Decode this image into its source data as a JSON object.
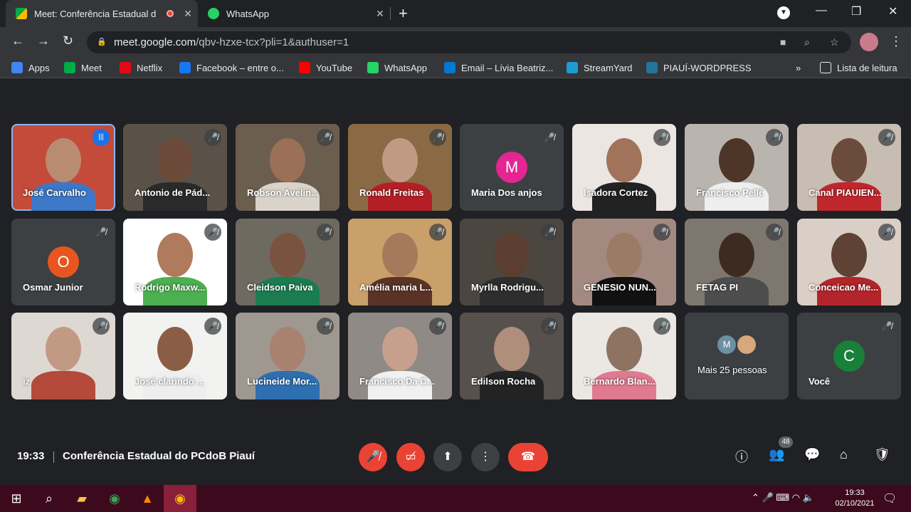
{
  "browser": {
    "tabs": [
      {
        "title": "Meet: Conferência Estadual d",
        "close": "✕"
      },
      {
        "title": "WhatsApp",
        "close": "✕"
      }
    ],
    "new_tab": "+",
    "url_host": "meet.google.com",
    "url_path": "/qbv-hzxe-tcx?pli=1&authuser=1",
    "window_controls": {
      "minimize": "—",
      "maximize": "❐",
      "close": "✕"
    }
  },
  "bookmarks": [
    {
      "label": "Apps",
      "icon": "apps-grid-icon",
      "color": "#4285f4"
    },
    {
      "label": "Meet",
      "icon": "meet-icon",
      "color": "#00ac47"
    },
    {
      "label": "Netflix",
      "icon": "netflix-icon",
      "color": "#e50914"
    },
    {
      "label": "Facebook – entre o...",
      "icon": "facebook-icon",
      "color": "#1877f2"
    },
    {
      "label": "YouTube",
      "icon": "youtube-icon",
      "color": "#ff0000"
    },
    {
      "label": "WhatsApp",
      "icon": "whatsapp-icon",
      "color": "#25d366"
    },
    {
      "label": "Email – Lívia Beatriz...",
      "icon": "outlook-icon",
      "color": "#0078d4"
    },
    {
      "label": "StreamYard",
      "icon": "streamyard-icon",
      "color": "#1d9bd1"
    },
    {
      "label": "PIAUÍ-WORDPRESS",
      "icon": "wordpress-icon",
      "color": "#21759b"
    }
  ],
  "bookmarks_overflow": "»",
  "reading_list": "Lista de leitura",
  "participants": [
    {
      "name": "José Carvalho",
      "speaking": true
    },
    {
      "name": "Antonio de Pád..."
    },
    {
      "name": "Robson Avelin..."
    },
    {
      "name": "Ronald Freitas"
    },
    {
      "name": "Maria Dos anjos",
      "avatar": "M",
      "avatar_color": "#e52592"
    },
    {
      "name": "Isadora Cortez"
    },
    {
      "name": "Francisco Pellê"
    },
    {
      "name": "Canal PIAUIEN..."
    },
    {
      "name": "Osmar Junior",
      "avatar": "O",
      "avatar_color": "#e8561f"
    },
    {
      "name": "Rodrigo Maxw..."
    },
    {
      "name": "Cleidson Paiva"
    },
    {
      "name": "Amélia maria L..."
    },
    {
      "name": "Myrlla Rodrigu..."
    },
    {
      "name": "GENESIO NUN..."
    },
    {
      "name": "FETAG PI"
    },
    {
      "name": "Conceicao Me..."
    },
    {
      "name": "iz"
    },
    {
      "name": "José clarindo ..."
    },
    {
      "name": "Lucineide Mor..."
    },
    {
      "name": "Francisco Da C..."
    },
    {
      "name": "Edilson Rocha"
    },
    {
      "name": "Bernardo Blan..."
    },
    {
      "name": "Mais 25 pessoas",
      "avatar": "M",
      "avatar_color": "#6d8fa3"
    },
    {
      "name": "Você",
      "avatar": "C",
      "avatar_color": "#188038"
    }
  ],
  "meeting": {
    "time": "19:33",
    "title": "Conferência Estadual do PCdoB Piauí",
    "participant_count": "48"
  },
  "taskbar": {
    "time": "19:33",
    "date": "02/10/2021"
  }
}
